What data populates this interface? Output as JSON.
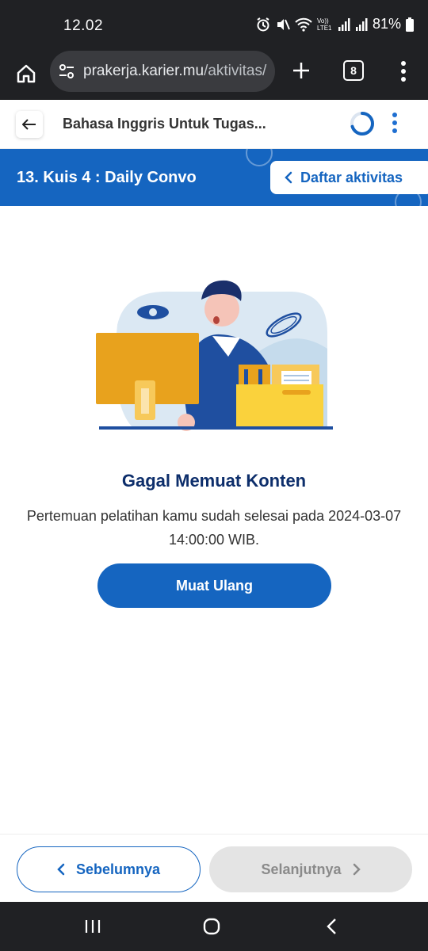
{
  "status_bar": {
    "time": "12.02",
    "battery": "81%",
    "network_label": "Vo)) LTE1"
  },
  "browser": {
    "url_host": "prakerja.karier.mu",
    "url_path": "/aktivitas/",
    "tab_count": "8"
  },
  "app_header": {
    "course_title": "Bahasa Inggris Untuk Tugas...",
    "progress": 0.7
  },
  "banner": {
    "activity_title": "13. Kuis 4 : Daily Convo",
    "daftar_label": "Daftar aktivitas"
  },
  "content": {
    "error_title": "Gagal Memuat Konten",
    "error_message": "Pertemuan pelatihan kamu sudah selesai pada 2024-03-07 14:00:00 WIB.",
    "reload_label": "Muat Ulang"
  },
  "bottom_nav": {
    "prev_label": "Sebelumnya",
    "next_label": "Selanjutnya"
  },
  "colors": {
    "primary": "#1565c0",
    "title": "#0d2e6b",
    "system_bar": "#202124"
  }
}
